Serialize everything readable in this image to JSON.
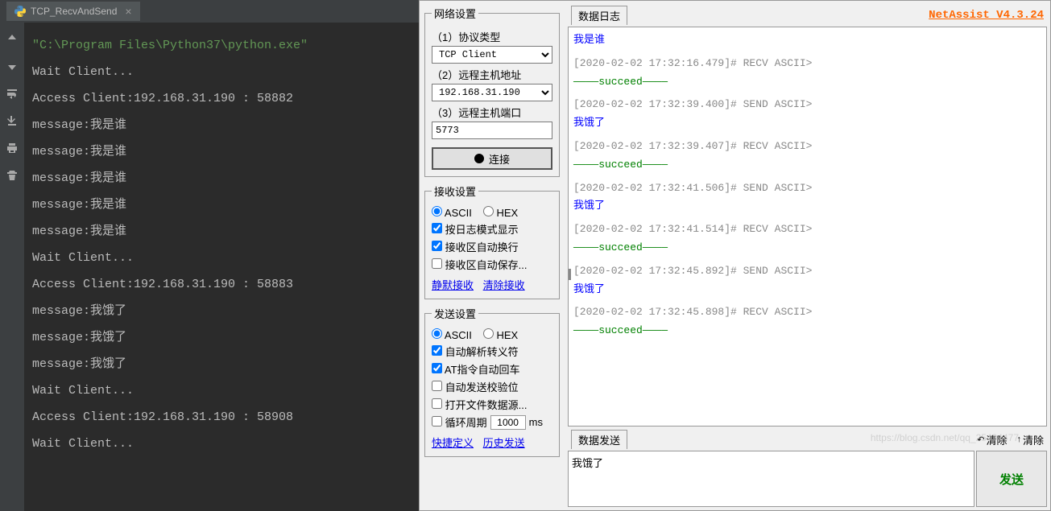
{
  "ide": {
    "tab_name": "TCP_RecvAndSend",
    "console_lines": [
      {
        "cls": "c-green",
        "text": "\"C:\\Program Files\\Python37\\python.exe\""
      },
      {
        "cls": "c-gray",
        "text": "Wait Client..."
      },
      {
        "cls": "c-gray",
        "text": "Access Client:192.168.31.190 : 58882"
      },
      {
        "cls": "c-gray",
        "text": "message:我是谁"
      },
      {
        "cls": "c-gray",
        "text": "message:我是谁"
      },
      {
        "cls": "c-gray",
        "text": "message:我是谁"
      },
      {
        "cls": "c-gray",
        "text": "message:我是谁"
      },
      {
        "cls": "c-gray",
        "text": "message:我是谁"
      },
      {
        "cls": "c-gray",
        "text": "Wait Client..."
      },
      {
        "cls": "c-gray",
        "text": "Access Client:192.168.31.190 : 58883"
      },
      {
        "cls": "c-gray",
        "text": "message:我饿了"
      },
      {
        "cls": "c-gray",
        "text": "message:我饿了"
      },
      {
        "cls": "c-gray",
        "text": "message:我饿了"
      },
      {
        "cls": "c-gray",
        "text": "Wait Client..."
      },
      {
        "cls": "c-gray",
        "text": "Access Client:192.168.31.190 : 58908"
      },
      {
        "cls": "c-gray",
        "text": "Wait Client..."
      }
    ]
  },
  "brand": "NetAssist V4.3.24",
  "network": {
    "legend": "网络设置",
    "proto_label": "（1）协议类型",
    "proto_value": "TCP Client",
    "host_label": "（2）远程主机地址",
    "host_value": "192.168.31.190",
    "port_label": "（3）远程主机端口",
    "port_value": "5773",
    "connect_label": "连接"
  },
  "recv": {
    "legend": "接收设置",
    "ascii": "ASCII",
    "hex": "HEX",
    "opt1": "按日志模式显示",
    "opt2": "接收区自动换行",
    "opt3": "接收区自动保存...",
    "link1": "静默接收",
    "link2": "清除接收"
  },
  "send": {
    "legend": "发送设置",
    "ascii": "ASCII",
    "hex": "HEX",
    "opt1": "自动解析转义符",
    "opt2": "AT指令自动回车",
    "opt3": "自动发送校验位",
    "opt4": "打开文件数据源...",
    "opt5_pre": "循环周期",
    "opt5_val": "1000",
    "opt5_suf": "ms",
    "link1": "快捷定义",
    "link2": "历史发送"
  },
  "log": {
    "legend": "数据日志",
    "entries": [
      {
        "ts": "",
        "msg": "我是谁",
        "succ": false
      },
      {
        "ts": "[2020-02-02 17:32:16.479]# RECV ASCII>",
        "msg": "",
        "succ": true
      },
      {
        "ts": "[2020-02-02 17:32:39.400]# SEND ASCII>",
        "msg": "我饿了",
        "succ": false
      },
      {
        "ts": "[2020-02-02 17:32:39.407]# RECV ASCII>",
        "msg": "",
        "succ": true
      },
      {
        "ts": "[2020-02-02 17:32:41.506]# SEND ASCII>",
        "msg": "我饿了",
        "succ": false
      },
      {
        "ts": "[2020-02-02 17:32:41.514]# RECV ASCII>",
        "msg": "",
        "succ": true
      },
      {
        "ts": "[2020-02-02 17:32:45.892]# SEND ASCII>",
        "msg": "我饿了",
        "succ": false
      },
      {
        "ts": "[2020-02-02 17:32:45.898]# RECV ASCII>",
        "msg": "",
        "succ": true
      }
    ],
    "succeed_text": "————succeed————"
  },
  "sendbox": {
    "legend": "数据发送",
    "clear1": "清除",
    "clear2": "清除",
    "value": "我饿了",
    "button": "发送"
  },
  "watermark": "https://blog.csdn.net/qq_25404477"
}
